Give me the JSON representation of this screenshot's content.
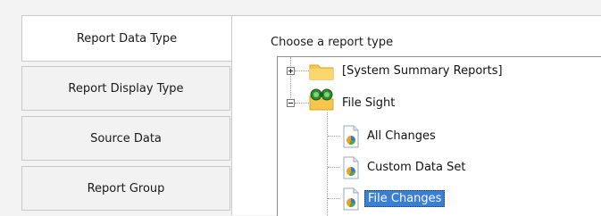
{
  "tabs": [
    {
      "label": "Report Data Type",
      "active": true
    },
    {
      "label": "Report Display Type",
      "active": false
    },
    {
      "label": "Source Data",
      "active": false
    },
    {
      "label": "Report Group",
      "active": false
    }
  ],
  "content": {
    "heading": "Choose a report type",
    "tree": {
      "nodes": [
        {
          "label": "[System Summary Reports]",
          "icon": "folder-icon",
          "expanded": false
        },
        {
          "label": "File Sight",
          "icon": "binoculars-folder-icon",
          "expanded": true,
          "children": [
            {
              "label": "All Changes",
              "icon": "report-icon"
            },
            {
              "label": "Custom Data Set",
              "icon": "report-icon"
            },
            {
              "label": "File Changes",
              "icon": "report-icon",
              "selected": true
            }
          ]
        }
      ]
    }
  },
  "colors": {
    "selection": "#3a7fd7",
    "folder": "#f7c64a",
    "binoculars": "#2e8b2e"
  }
}
